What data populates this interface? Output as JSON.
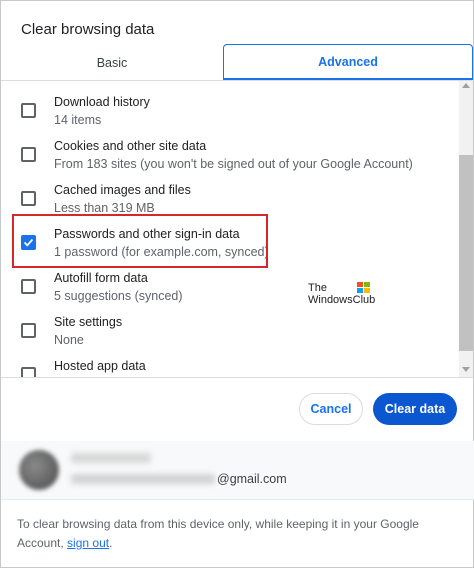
{
  "dialog": {
    "title": "Clear browsing data"
  },
  "tabs": [
    {
      "label": "Basic",
      "active": false
    },
    {
      "label": "Advanced",
      "active": true
    }
  ],
  "items": [
    {
      "label": "Download history",
      "sub": "14 items",
      "checked": false
    },
    {
      "label": "Cookies and other site data",
      "sub": "From 183 sites (you won't be signed out of your Google Account)",
      "checked": false
    },
    {
      "label": "Cached images and files",
      "sub": "Less than 319 MB",
      "checked": false
    },
    {
      "label": "Passwords and other sign-in data",
      "sub": "1 password (for example.com, synced)",
      "checked": true
    },
    {
      "label": "Autofill form data",
      "sub": "5 suggestions (synced)",
      "checked": false
    },
    {
      "label": "Site settings",
      "sub": "None",
      "checked": false
    },
    {
      "label": "Hosted app data",
      "sub": "",
      "checked": false
    }
  ],
  "watermark": {
    "line1": "The",
    "line2": "WindowsClub"
  },
  "buttons": {
    "cancel": "Cancel",
    "clear": "Clear data"
  },
  "account": {
    "email_suffix": "@gmail.com"
  },
  "footer": {
    "text": "To clear browsing data from this device only, while keeping it in your Google Account,",
    "link": "sign out",
    "end": "."
  },
  "colors": {
    "accent": "#1a73e8",
    "primary_button": "#0b57d0",
    "highlight_box": "#d62828"
  }
}
